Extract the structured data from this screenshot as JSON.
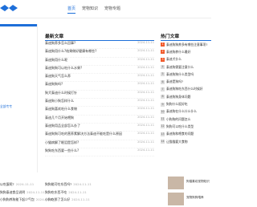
{
  "nav": {
    "items": [
      "首页",
      "宠物知识",
      "宠物专题"
    ],
    "active_index": 0
  },
  "left": {
    "note": "全部专专"
  },
  "latest": {
    "title": "最新文章",
    "items": [
      {
        "text": "泰迪狗养多怎么回事?",
        "date": "2024-11-11"
      },
      {
        "text": "泰迪狗用什么?结果做好健康有哪些?",
        "date": "2024-11-11"
      },
      {
        "text": "泰迪狗用什么呢",
        "date": "2024-11-11"
      },
      {
        "text": "泰迪狗狗可以吃什么水果?",
        "date": "2024-11-11"
      },
      {
        "text": "泰迪狗天气怎么养",
        "date": "2024-11-11"
      },
      {
        "text": "泰迪狗狗吗?",
        "date": "2024-11-11"
      },
      {
        "text": "狗犬泰迪什么时候打针",
        "date": "2024-11-11"
      },
      {
        "text": "泰迪狗小狗怎样什么",
        "date": "2024-11-11"
      },
      {
        "text": "泰迪狗喜欢吃什么食物",
        "date": "2024-11-11"
      },
      {
        "text": "泰迪几个月开始喂狗",
        "date": "2024-11-11"
      },
      {
        "text": "泰迪狗用品全部怎么办了",
        "date": "2024-11-11"
      },
      {
        "text": "泰迪狗狗可吃的营养素解决方法泰迪不能吃是什么原因",
        "date": "2024-11-11"
      },
      {
        "text": "小猫病解了眼泪是怎样?",
        "date": "2024-11-11"
      },
      {
        "text": "狗狗吃东西要一些什么?",
        "date": "2024-11-11"
      }
    ]
  },
  "hot": {
    "title": "热门文章",
    "items": [
      {
        "num": "1",
        "text": "泰迪狗狗养多有哪些注意事项?"
      },
      {
        "num": "2",
        "text": "泰迪狗养什么最好"
      },
      {
        "num": "3",
        "text": "泰迪犬什么"
      },
      {
        "num": "4",
        "text": "泰迪狗需要注意什么"
      },
      {
        "num": "5",
        "text": "泰迪狗狗什么类型吗"
      },
      {
        "num": "6",
        "text": "泰迪是狗吗?"
      },
      {
        "num": "7",
        "text": "泰迪狗狗吃东西什么时候好"
      },
      {
        "num": "8",
        "text": "泰迪狗狗身体问题"
      },
      {
        "num": "9",
        "text": "狗狗什么饭好吃"
      },
      {
        "num": "10",
        "text": "泰迪狗在什么什么什么"
      },
      {
        "num": "11",
        "text": "小狗狗的问题怎么"
      },
      {
        "num": "12",
        "text": "狗狗可以吃什么类型"
      },
      {
        "num": "13",
        "text": "泰迪狗和喂食的问题"
      },
      {
        "num": "14",
        "text": "让猫猫要大食物"
      }
    ]
  },
  "bottom_left": {
    "items": [
      {
        "text": "以吃蛋呢?",
        "date": "2024-11-11"
      },
      {
        "text": "狗狗泰迪食品说明",
        "date": "2024-11-11"
      },
      {
        "text": "小狗狗养狗能下起少气包",
        "date": "2024-11-11"
      }
    ]
  },
  "bottom_mid": {
    "items": [
      {
        "text": "狗狗能可吃东西吗?",
        "date": "2024-11-11"
      },
      {
        "text": "狗狗吃东西不吃",
        "date": "2024-11-11"
      },
      {
        "text": "小狗吃那了怎么好",
        "date": "2024-11-11"
      }
    ]
  },
  "thumbs": [
    {
      "text": "狗猫喜欢宠物知识"
    },
    {
      "text": "宠物狗狗喂养"
    }
  ],
  "colors": {
    "accent": "#1e6fd9",
    "hot": "#f15a2b"
  }
}
